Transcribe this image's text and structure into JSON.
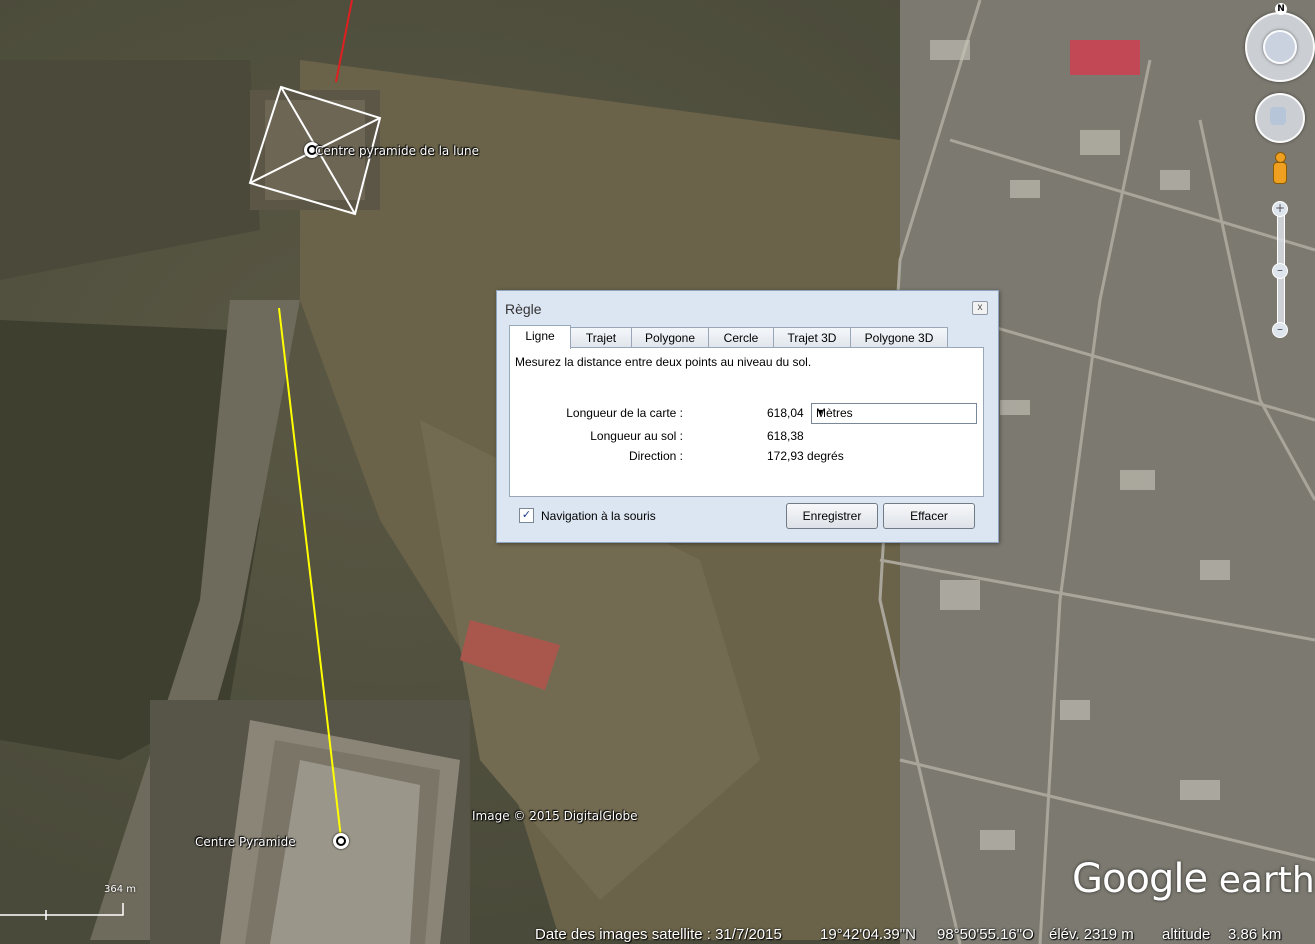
{
  "map": {
    "placemark_moon": "Centre pyramide de la lune",
    "placemark_pyramid": "Centre Pyramide",
    "copyright": "Image © 2015 DigitalGlobe",
    "scale": "364 m",
    "line_color": "#ffff00"
  },
  "dialog": {
    "title": "Règle",
    "close_glyph": "x",
    "tabs": [
      "Ligne",
      "Trajet",
      "Polygone",
      "Cercle",
      "Trajet 3D",
      "Polygone 3D"
    ],
    "active_tab": "Ligne",
    "description": "Mesurez la distance entre deux points au niveau du sol.",
    "map_length_label": "Longueur de la carte :",
    "map_length_value": "618,04",
    "unit": "Mètres",
    "ground_length_label": "Longueur au sol :",
    "ground_length_value": "618,38",
    "direction_label": "Direction :",
    "direction_value": "172,93 degrés",
    "mouse_nav_label": "Navigation à la souris",
    "mouse_nav_checked": true,
    "save_label": "Enregistrer",
    "clear_label": "Effacer"
  },
  "status_bar": {
    "imagery_date": "Date des images satellite : 31/7/2015",
    "lat": "19°42'04.39\"N",
    "lon": "98°50'55.16\"O",
    "elev": "élév. 2319 m",
    "altitude_label": "altitude",
    "altitude_value": "3.86 km"
  },
  "logo": {
    "google": "Google",
    "earth": "earth"
  },
  "nav": {
    "north": "N"
  }
}
